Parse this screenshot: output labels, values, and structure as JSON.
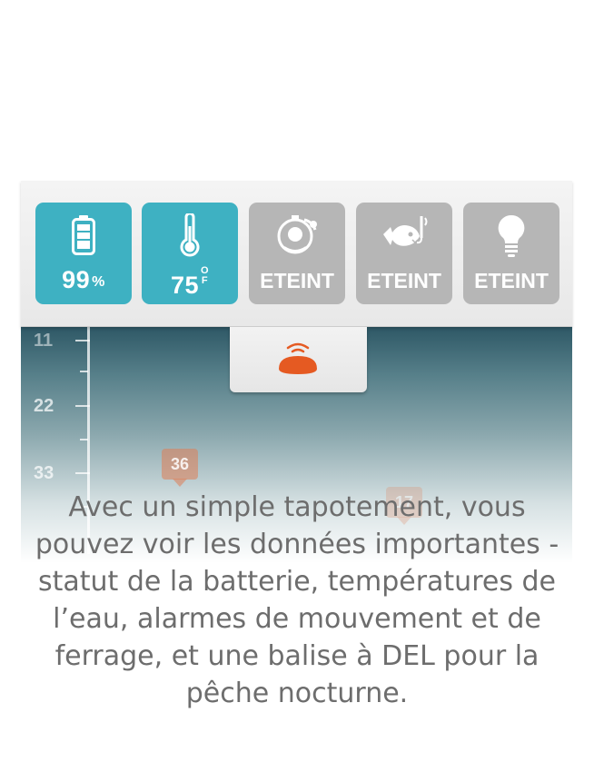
{
  "status_panel": {
    "tiles": [
      {
        "name": "battery",
        "value": "99",
        "unit": "%",
        "icon": "battery-icon",
        "active": true
      },
      {
        "name": "water-temperature",
        "value": "75",
        "unit_top": "O",
        "unit_bottom": "F",
        "icon": "thermometer-icon",
        "active": true
      },
      {
        "name": "motion-alarm",
        "value": "ETEINT",
        "icon": "alarm-icon",
        "active": false
      },
      {
        "name": "fish-alarm",
        "value": "ETEINT",
        "icon": "fish-alarm-icon",
        "active": false
      },
      {
        "name": "led-beacon",
        "value": "ETEINT",
        "icon": "light-bulb-icon",
        "active": false
      }
    ],
    "colors": {
      "active": "#3eb1c2",
      "inactive": "#b6b6b6"
    }
  },
  "pull_tab": {
    "icon": "sonar-device-icon",
    "color": "#e55a22"
  },
  "sonar": {
    "depth_labels": [
      "11",
      "22",
      "33"
    ],
    "fish_markers": [
      "36",
      "17"
    ],
    "marker_color": "#de7d56"
  },
  "caption": {
    "text": "Avec un simple tapotement, vous pouvez voir les données importantes - statut de la batterie, températures de l’eau, alarmes de mouvement et de ferrage, et une balise à DEL pour la pêche nocturne."
  }
}
